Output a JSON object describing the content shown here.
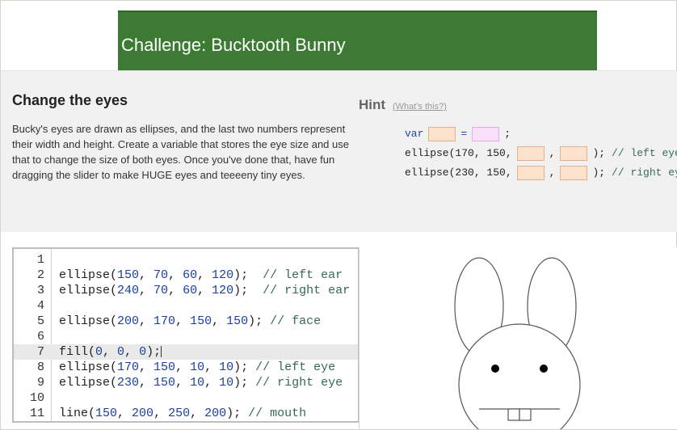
{
  "banner": {
    "title": "Challenge: Bucktooth Bunny"
  },
  "instructions": {
    "title": "Change the eyes",
    "body": "Bucky's eyes are drawn as ellipses, and the last two numbers represent their width and height. Create a variable that stores the eye size and use that to change the size of both eyes. Once you've done that, have fun dragging the slider to make HUGE eyes and teeeeny tiny eyes."
  },
  "hint": {
    "title": "Hint",
    "help_link": "(What's this?)",
    "line1": {
      "keyword": "var",
      "equals": "=",
      "semicolon": ";"
    },
    "line2": {
      "prefix": "ellipse(170, 150,",
      "comma": ",",
      "suffix": ");",
      "comment": "// left eye"
    },
    "line3": {
      "prefix": "ellipse(230, 150,",
      "comma": ",",
      "suffix": ");",
      "comment": "// right eye"
    }
  },
  "editor": {
    "active_line": 7,
    "lines": [
      {
        "n": "1",
        "code": "",
        "comment": ""
      },
      {
        "n": "2",
        "code": "ellipse(150, 70, 60, 120);",
        "comment": "  // left ear"
      },
      {
        "n": "3",
        "code": "ellipse(240, 70, 60, 120);",
        "comment": "  // right ear"
      },
      {
        "n": "4",
        "code": "",
        "comment": ""
      },
      {
        "n": "5",
        "code": "ellipse(200, 170, 150, 150);",
        "comment": " // face"
      },
      {
        "n": "6",
        "code": "",
        "comment": ""
      },
      {
        "n": "7",
        "code": "fill(0, 0, 0);",
        "comment": ""
      },
      {
        "n": "8",
        "code": "ellipse(170, 150, 10, 10);",
        "comment": " // left eye"
      },
      {
        "n": "9",
        "code": "ellipse(230, 150, 10, 10);",
        "comment": " // right eye"
      },
      {
        "n": "10",
        "code": "",
        "comment": ""
      },
      {
        "n": "11",
        "code": "line(150, 200, 250, 200);",
        "comment": " // mouth"
      }
    ]
  },
  "canvas": {
    "stroke_color": "#555555",
    "fill_color": "#ffffff",
    "eye_color": "#000000"
  }
}
